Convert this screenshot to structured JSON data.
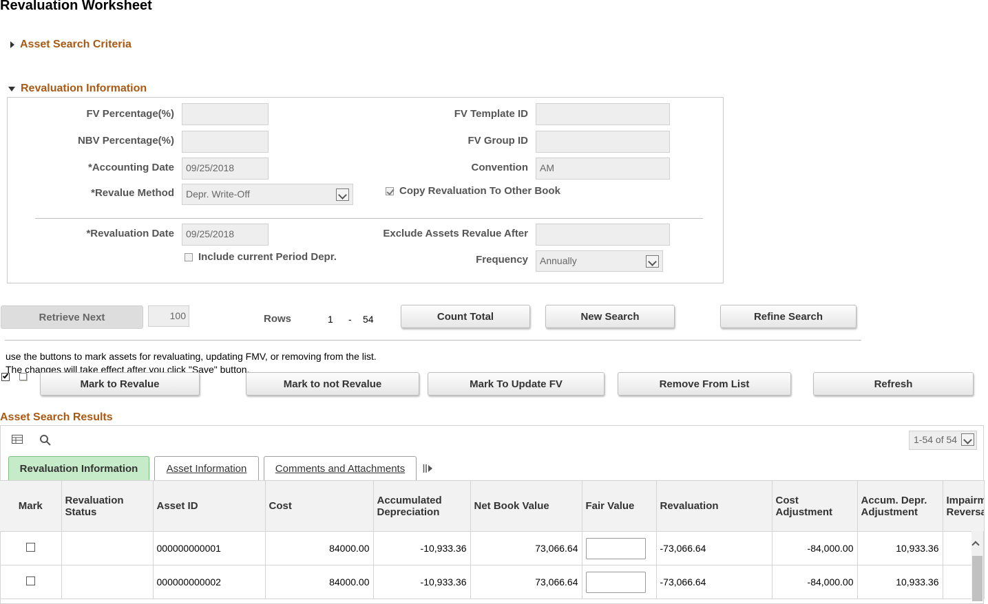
{
  "page_title": "Revaluation Worksheet",
  "asset_search_criteria": {
    "label": "Asset Search Criteria"
  },
  "revaluation_information": {
    "label": "Revaluation Information",
    "fv_percentage": {
      "label": "FV Percentage(%)",
      "value": ""
    },
    "nbv_percentage": {
      "label": "NBV Percentage(%)",
      "value": ""
    },
    "accounting_date": {
      "label": "*Accounting Date",
      "value": "09/25/2018"
    },
    "revalue_method": {
      "label": "*Revalue Method",
      "value": "Depr. Write-Off"
    },
    "fv_template_id": {
      "label": "FV Template ID",
      "value": ""
    },
    "fv_group_id": {
      "label": "FV Group ID",
      "value": ""
    },
    "convention": {
      "label": "Convention",
      "value": "AM"
    },
    "copy_revaluation": {
      "label": "Copy Revaluation To Other Book",
      "checked": true
    },
    "revaluation_date": {
      "label": "*Revaluation Date",
      "value": "09/25/2018"
    },
    "include_current_period": {
      "label": "Include current Period Depr.",
      "checked": false
    },
    "exclude_after": {
      "label": "Exclude Assets Revalue After",
      "value": ""
    },
    "frequency": {
      "label": "Frequency",
      "value": "Annually"
    }
  },
  "retrieval": {
    "retrieve_next_label": "Retrieve Next",
    "retrieve_count": "100",
    "rows_label": "Rows",
    "rows_from": "1",
    "rows_sep": "-",
    "rows_to": "54",
    "count_total_label": "Count Total",
    "new_search_label": "New Search",
    "refine_search_label": "Refine Search"
  },
  "instructions": {
    "line1": "use the buttons to mark assets for revaluating, updating FMV, or removing from the list.",
    "line2": "The changes will take effect after you click \"Save\" button."
  },
  "actions": {
    "mark_to_revalue": "Mark to Revalue",
    "mark_not_revalue": "Mark to not Revalue",
    "mark_update_fv": "Mark To Update FV",
    "remove_from_list": "Remove From List",
    "refresh": "Refresh"
  },
  "results": {
    "label": "Asset Search Results",
    "pager": "1-54 of 54",
    "tabs": [
      "Revaluation Information",
      "Asset Information",
      "Comments and Attachments"
    ],
    "columns": [
      "Mark",
      "Revaluation Status",
      "Asset ID",
      "Cost",
      "Accumulated Depreciation",
      "Net Book Value",
      "Fair Value",
      "Revaluation",
      "Cost Adjustment",
      "Accum. Depr. Adjustment",
      "Impairment Reversal"
    ],
    "rows": [
      {
        "asset_id": "000000000001",
        "cost": "84000.00",
        "accum_depr": "-10,933.36",
        "nbv": "73,066.64",
        "revaluation": "-73,066.64",
        "cost_adj": "-84,000.00",
        "accum_adj": "10,933.36"
      },
      {
        "asset_id": "000000000002",
        "cost": "84000.00",
        "accum_depr": "-10,933.36",
        "nbv": "73,066.64",
        "revaluation": "-73,066.64",
        "cost_adj": "-84,000.00",
        "accum_adj": "10,933.36"
      }
    ]
  },
  "colors": {
    "accent": "#a85a14",
    "active_tab": "#c6ebc9"
  }
}
